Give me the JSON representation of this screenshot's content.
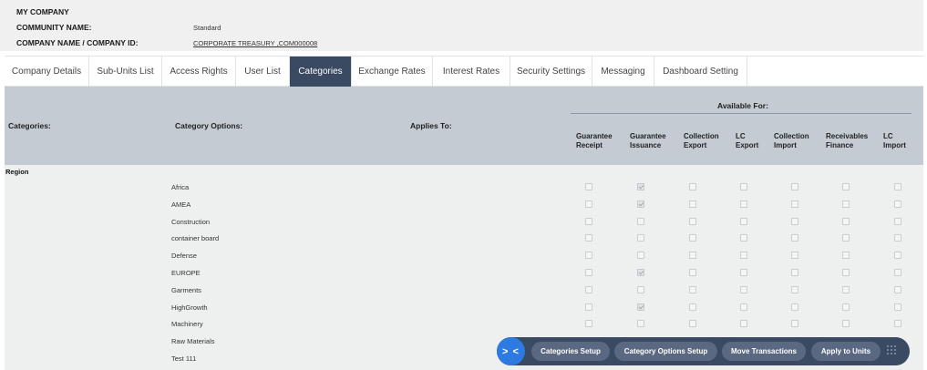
{
  "company": {
    "title": "MY COMPANY",
    "community_label": "COMMUNITY NAME:",
    "community_value": "Standard",
    "company_label": "COMPANY NAME / COMPANY ID:",
    "company_value": "CORPORATE TREASURY ,COM000008"
  },
  "tabs": [
    {
      "label": "Company Details",
      "active": false
    },
    {
      "label": "Sub-Units List",
      "active": false
    },
    {
      "label": "Access Rights",
      "active": false
    },
    {
      "label": "User List",
      "active": false
    },
    {
      "label": "Categories",
      "active": true
    },
    {
      "label": "Exchange Rates",
      "active": false
    },
    {
      "label": "Interest Rates",
      "active": false
    },
    {
      "label": "Security Settings",
      "active": false
    },
    {
      "label": "Messaging",
      "active": false
    },
    {
      "label": "Dashboard Setting",
      "active": false
    }
  ],
  "table": {
    "categories_header": "Categories:",
    "options_header": "Category Options:",
    "applies_header": "Applies To:",
    "available_for": "Available For:",
    "columns": [
      {
        "line1": "Guarantee",
        "line2": "Receipt"
      },
      {
        "line1": "Guarantee",
        "line2": "Issuance"
      },
      {
        "line1": "Collection",
        "line2": "Export"
      },
      {
        "line1": "LC",
        "line2": "Export"
      },
      {
        "line1": "Collection",
        "line2": "Import"
      },
      {
        "line1": "Receivables",
        "line2": "Finance"
      },
      {
        "line1": "LC",
        "line2": "Import"
      }
    ],
    "group": "Region",
    "rows": [
      {
        "label": "Africa",
        "checks": [
          false,
          true,
          false,
          false,
          false,
          false,
          false
        ]
      },
      {
        "label": "AMEA",
        "checks": [
          false,
          true,
          false,
          false,
          false,
          false,
          false
        ]
      },
      {
        "label": "Construction",
        "checks": [
          false,
          false,
          false,
          false,
          false,
          false,
          false
        ]
      },
      {
        "label": "container board",
        "checks": [
          false,
          false,
          false,
          false,
          false,
          false,
          false
        ]
      },
      {
        "label": "Defense",
        "checks": [
          false,
          false,
          false,
          false,
          false,
          false,
          false
        ]
      },
      {
        "label": "EUROPE",
        "checks": [
          false,
          true,
          false,
          false,
          false,
          false,
          false
        ]
      },
      {
        "label": "Garments",
        "checks": [
          false,
          false,
          false,
          false,
          false,
          false,
          false
        ]
      },
      {
        "label": "HighGrowth",
        "checks": [
          false,
          true,
          false,
          false,
          false,
          false,
          false
        ]
      },
      {
        "label": "Machinery",
        "checks": [
          false,
          false,
          false,
          false,
          false,
          false,
          false
        ]
      },
      {
        "label": "Raw Materials",
        "checks": [
          false,
          false,
          false,
          false,
          false,
          false,
          false
        ]
      },
      {
        "label": "Test 111",
        "checks": [
          false,
          false,
          false,
          false,
          false,
          false,
          false
        ]
      }
    ]
  },
  "actions": {
    "toggle_icon": "chevron-right-left-icon",
    "toggle_label": "> <",
    "buttons": [
      "Categories Setup",
      "Category Options Setup",
      "Move Transactions",
      "Apply to Units"
    ],
    "grip_icon": "grip-dots-icon"
  },
  "colors": {
    "accent": "#2d7be0",
    "active_tab": "#3a4a63",
    "header_bg": "#c4cbd3",
    "action_bar": "#3b4a63"
  }
}
